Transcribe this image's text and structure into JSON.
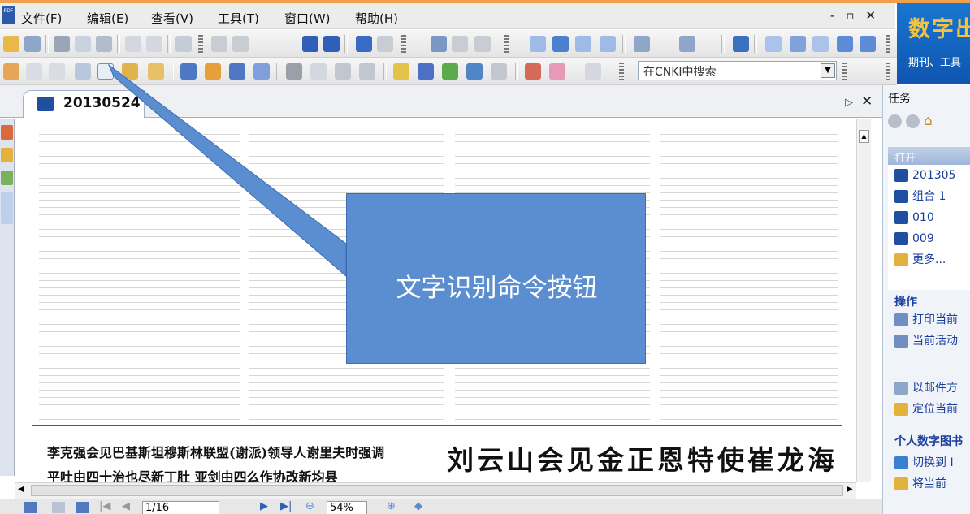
{
  "menu": {
    "items": [
      "文件(F)",
      "编辑(E)",
      "查看(V)",
      "工具(T)",
      "窗口(W)",
      "帮助(H)"
    ],
    "window_controls": "- ✕"
  },
  "brand": {
    "title": "数字出",
    "subtitle": "期刊、工具"
  },
  "toolbar": {
    "search_placeholder": "在CNKI中搜索"
  },
  "tab": {
    "label": "20130524"
  },
  "document": {
    "headline_left_1": "李克强会见巴基斯坦穆斯林联盟(谢派)领导人谢里夫时强调",
    "headline_left_2": "平吐由四十治也尽新丁肚 亚剑由四么作协改新均县",
    "headline_right": "刘云山会见金正恩特使崔龙海"
  },
  "navbar": {
    "page": "1/16",
    "zoom": "54%"
  },
  "taskpane": {
    "title": "任务",
    "open_header": "打开",
    "open_items": [
      "201305",
      "组合 1",
      "010",
      "009",
      "更多..."
    ],
    "ops_header": "操作",
    "ops_items": [
      "打印当前",
      "当前活动"
    ],
    "share_items": [
      "以邮件方",
      "定位当前"
    ],
    "personal_header": "个人数字图书",
    "personal_items": [
      "切换到 I",
      "将当前"
    ]
  },
  "callout": {
    "text": "文字识别命令按钮"
  },
  "colors": {
    "callout_fill": "#5a8ed0",
    "brand_bg": "#1565c0",
    "brand_title": "#f4c23c",
    "link_blue": "#1a3e9c"
  }
}
